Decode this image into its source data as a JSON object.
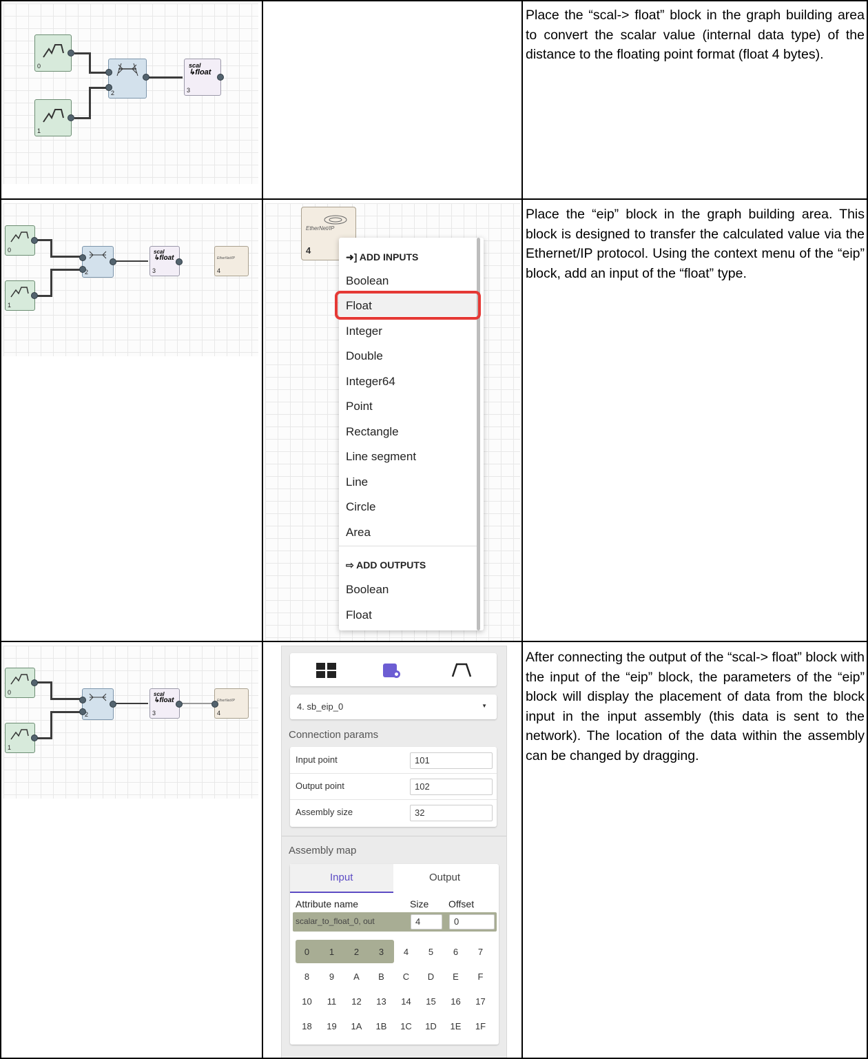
{
  "rows": [
    {
      "description": "Place the “scal-> float” block in the graph building area to convert the scalar value (internal data type) of the distance to the floating point format (float 4 bytes).",
      "graph": {
        "block_ids": [
          "0",
          "1",
          "2",
          "3"
        ],
        "converter_label_top": "scal",
        "converter_label_bottom": "float"
      }
    },
    {
      "description": "Place the “eip” block in the graph building area. This block is designed to transfer the calculated value via the Ethernet/IP protocol. Using the context menu of the “eip” block, add an input of the “float” type.",
      "graph": {
        "block_ids": [
          "0",
          "1",
          "2",
          "3",
          "4"
        ],
        "converter_label_top": "scal",
        "converter_label_bottom": "float",
        "eip_logo": "EtherNet/IP"
      },
      "menu": {
        "block_logo": "EtherNet/IP",
        "block_id": "4",
        "add_inputs_header": "ADD INPUTS",
        "input_items": [
          "Boolean",
          "Float",
          "Integer",
          "Double",
          "Integer64",
          "Point",
          "Rectangle",
          "Line segment",
          "Line",
          "Circle",
          "Area"
        ],
        "add_outputs_header": "ADD OUTPUTS",
        "output_items": [
          "Boolean",
          "Float"
        ],
        "highlighted_item": "Float",
        "highlight_color": "#e53935"
      }
    },
    {
      "description": "After connecting the output of the “scal-> float” block with the input of the “eip” block, the parameters of the “eip” block will display the placement of data from the block input in the input assembly (this data is sent to the network). The location of the data within the assembly can be changed by dragging.",
      "graph": {
        "block_ids": [
          "0",
          "1",
          "2",
          "3",
          "4"
        ],
        "converter_label_top": "scal",
        "converter_label_bottom": "float",
        "eip_logo": "EtherNet/IP"
      },
      "panel": {
        "tab_icons": [
          "blocks-grid-icon",
          "block-settings-icon",
          "graph-icon"
        ],
        "block_select": "4. sb_eip_0",
        "connection_title": "Connection params",
        "params": [
          {
            "label": "Input point",
            "value": "101"
          },
          {
            "label": "Output point",
            "value": "102"
          },
          {
            "label": "Assembly size",
            "value": "32"
          }
        ],
        "assembly_title": "Assembly map",
        "tabs": [
          "Input",
          "Output"
        ],
        "active_tab": "Input",
        "columns": [
          "Attribute name",
          "Size",
          "Offset"
        ],
        "attribute": {
          "name": "scalar_to_float_0, out",
          "size": "4",
          "offset": "0"
        },
        "bytes": [
          [
            "0",
            "1",
            "2",
            "3",
            "4",
            "5",
            "6",
            "7"
          ],
          [
            "8",
            "9",
            "A",
            "B",
            "C",
            "D",
            "E",
            "F"
          ],
          [
            "10",
            "11",
            "12",
            "13",
            "14",
            "15",
            "16",
            "17"
          ],
          [
            "18",
            "19",
            "1A",
            "1B",
            "1C",
            "1D",
            "1E",
            "1F"
          ]
        ],
        "used_bytes": 4,
        "accent": "#5c4bc4",
        "used_color": "#a8ad94"
      }
    }
  ]
}
